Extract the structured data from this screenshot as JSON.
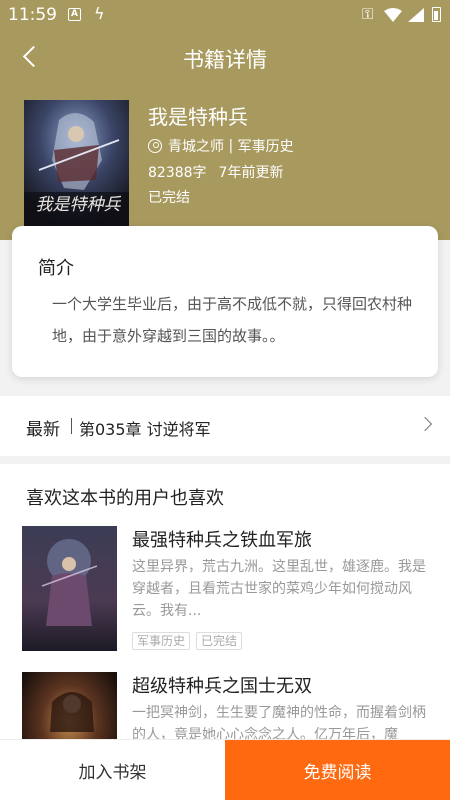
{
  "status_bar": {
    "time": "11:59",
    "icon_a": "A"
  },
  "nav": {
    "title": "书籍详情"
  },
  "book": {
    "title": "我是特种兵",
    "author": "青城之师",
    "category": "军事历史",
    "word_count": "82388字",
    "updated": "7年前更新",
    "status": "已完结",
    "cover_text": "我是特种兵"
  },
  "intro": {
    "heading": "简介",
    "body": "一个大学生毕业后，由于高不成低不就，只得回农村种地，由于意外穿越到三国的故事。。"
  },
  "latest": {
    "label": "最新",
    "chapter": "第035章 讨逆将军"
  },
  "recommend": {
    "heading": "喜欢这本书的用户也喜欢",
    "items": [
      {
        "title": "最强特种兵之铁血军旅",
        "desc": "这里异界，荒古九洲。这里乱世，雄逐鹿。我是穿越者，且看荒古世家的菜鸡少年如何搅动风云。我有...",
        "tags": [
          "军事历史",
          "已完结"
        ]
      },
      {
        "title": "超级特种兵之国士无双",
        "desc": "一把冥神剑，生生要了魔神的性命，而握着剑柄的人，竟是她心心念念之人。亿万年后，魔"
      }
    ]
  },
  "bottom": {
    "add_shelf": "加入书架",
    "free_read": "免费阅读"
  },
  "colors": {
    "header_bg": "#a89a5e",
    "accent": "#ff6a10"
  }
}
